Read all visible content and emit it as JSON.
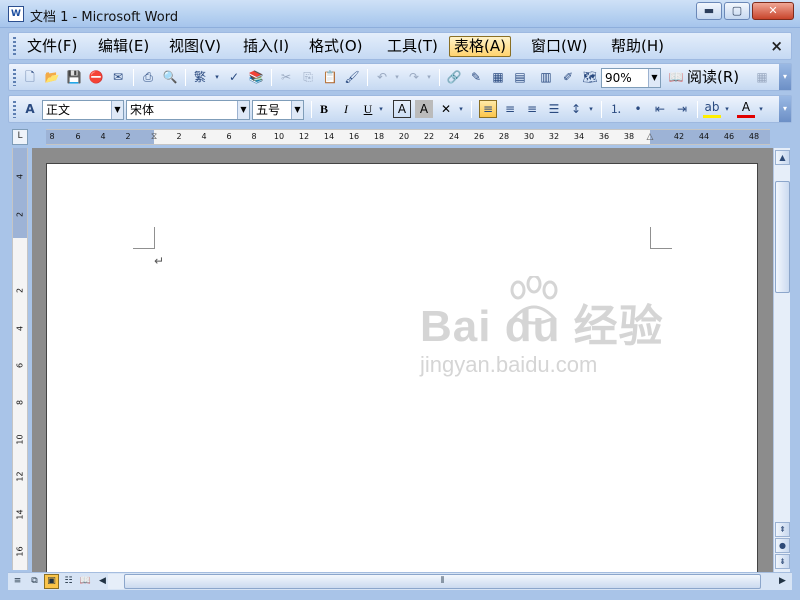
{
  "window": {
    "title": "文档 1 - Microsoft Word",
    "icon": "word-doc-icon",
    "controls": {
      "minimize": "▬",
      "maximize": "▢",
      "close": "✕"
    }
  },
  "menubar": {
    "items": [
      {
        "label": "文件(F)"
      },
      {
        "label": "编辑(E)"
      },
      {
        "label": "视图(V)"
      },
      {
        "label": "插入(I)"
      },
      {
        "label": "格式(O)"
      },
      {
        "label": "工具(T)"
      },
      {
        "label": "表格(A)",
        "active": true
      },
      {
        "label": "窗口(W)"
      },
      {
        "label": "帮助(H)"
      }
    ],
    "close_glyph": "×"
  },
  "standard_toolbar": {
    "zoom_value": "90%",
    "read_label": "阅读(R)"
  },
  "formatting_toolbar": {
    "style_value": "正文",
    "font_value": "宋体",
    "size_value": "五号",
    "bold": "B",
    "italic": "I",
    "underline": "U",
    "align_left_active": true
  },
  "ruler": {
    "horizontal_ticks": [
      "8",
      "6",
      "4",
      "2",
      "2",
      "4",
      "6",
      "8",
      "10",
      "12",
      "14",
      "16",
      "18",
      "20",
      "22",
      "24",
      "26",
      "28",
      "30",
      "32",
      "34",
      "36",
      "38",
      "42",
      "44",
      "46",
      "48"
    ],
    "vertical_ticks": [
      "4",
      "2",
      "2",
      "4",
      "6",
      "8",
      "10",
      "12",
      "14",
      "16"
    ]
  },
  "document": {
    "paragraph_mark": "↵"
  },
  "watermark": {
    "logo_text": "Bai du 经验",
    "url": "jingyan.baidu.com"
  },
  "colors": {
    "accent_active": "#fbc54a",
    "toolbar_bg": "#c6d9f2",
    "page_bg": "#ffffff",
    "workspace_bg": "#8c8c8c"
  }
}
